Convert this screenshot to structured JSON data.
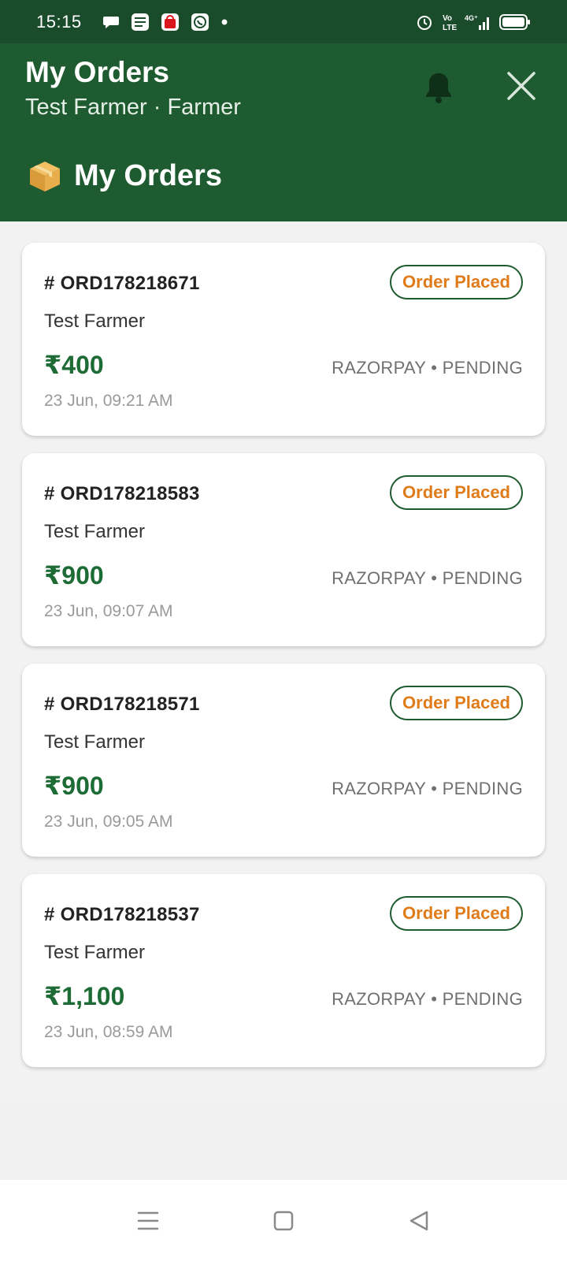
{
  "status_bar": {
    "time": "15:15",
    "left_icons": [
      "chat-bubble-icon",
      "news-icon",
      "shopping-bag-icon",
      "whatsapp-icon",
      "dot-icon"
    ],
    "right_icons": [
      "alarm-icon",
      "volte-icon",
      "signal-4g-icon",
      "battery-icon"
    ]
  },
  "header": {
    "title": "My Orders",
    "subtitle": "Test Farmer · Farmer",
    "bell_icon": "bell-icon",
    "close_icon": "close-icon"
  },
  "section": {
    "icon": "package-icon",
    "title": "My Orders"
  },
  "orders": [
    {
      "id": "# ORD178218671",
      "name": "Test Farmer",
      "amount": "₹400",
      "payment": "RAZORPAY • PENDING",
      "date": "23 Jun, 09:21 AM",
      "status": "Order Placed"
    },
    {
      "id": "# ORD178218583",
      "name": "Test Farmer",
      "amount": "₹900",
      "payment": "RAZORPAY • PENDING",
      "date": "23 Jun, 09:07 AM",
      "status": "Order Placed"
    },
    {
      "id": "# ORD178218571",
      "name": "Test Farmer",
      "amount": "₹900",
      "payment": "RAZORPAY • PENDING",
      "date": "23 Jun, 09:05 AM",
      "status": "Order Placed"
    },
    {
      "id": "# ORD178218537",
      "name": "Test Farmer",
      "amount": "₹1,100",
      "payment": "RAZORPAY • PENDING",
      "date": "23 Jun, 08:59 AM",
      "status": "Order Placed"
    }
  ],
  "nav": {
    "menu_icon": "menu-icon",
    "home_icon": "home-square-icon",
    "back_icon": "back-triangle-icon"
  },
  "colors": {
    "header_green": "#1f5b30",
    "status_green": "#1a4b2b",
    "amount_green": "#1d6b35",
    "badge_orange": "#e07b1a"
  }
}
